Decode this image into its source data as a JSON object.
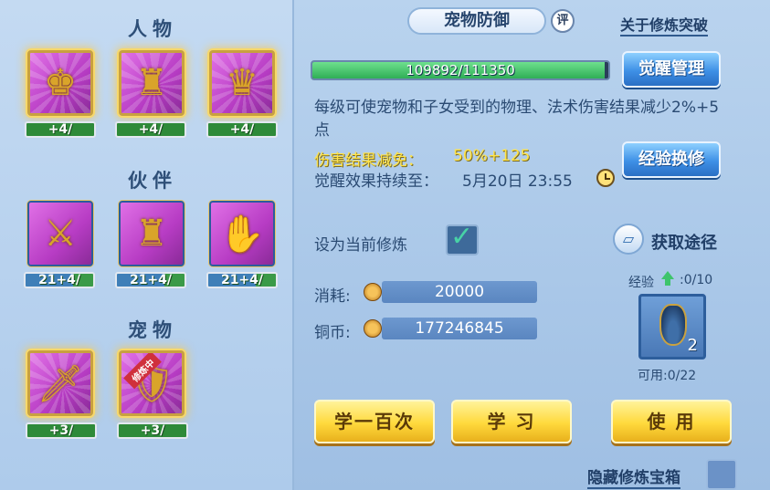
{
  "left": {
    "sections": [
      {
        "title": "人物"
      },
      {
        "title": "伙伴"
      },
      {
        "title": "宠物"
      }
    ],
    "character_slots": [
      {
        "level": "+4/"
      },
      {
        "level": "+4/"
      },
      {
        "level": "+4/"
      }
    ],
    "partner_slots": [
      {
        "level": "21+4/"
      },
      {
        "level": "21+4/"
      },
      {
        "level": "21+4/"
      }
    ],
    "pet_slots": [
      {
        "level": "+3/",
        "tag": ""
      },
      {
        "level": "+3/",
        "tag": "修炼中"
      }
    ]
  },
  "header": {
    "title": "宠物防御",
    "rate_icon": "评",
    "breakthrough_link": "关于修炼突破"
  },
  "progress": {
    "text": "109892/111350",
    "current": 109892,
    "max": 111350
  },
  "buttons": {
    "awaken": "觉醒管理",
    "exchange": "经验换修",
    "learn_100": "学一百次",
    "learn": "学 习",
    "use": "使 用"
  },
  "details": {
    "description": "每级可使宠物和子女受到的物理、法术伤害结果减少2%+5点",
    "reduction_label": "伤害结果减免：",
    "reduction_value": "50%+125",
    "expire_label": "觉醒效果持续至：",
    "expire_value": "5月20日 23:55"
  },
  "settings": {
    "set_current_label": "设为当前修炼",
    "get_source_label": "获取途径"
  },
  "resources": {
    "cost_label": "消耗:",
    "cost_value": "20000",
    "copper_label": "铜币:",
    "copper_value": "177246845"
  },
  "item": {
    "exp_label": "经验",
    "exp_value": ":0/10",
    "count": "2",
    "available": "可用:0/22"
  },
  "footer": {
    "hide_chest_label": "隐藏修炼宝箱"
  },
  "colors": {
    "accent_blue": "#3e90e6",
    "gold_button": "#ffd93c",
    "highlight_yellow": "#ffe34a",
    "progress_green": "#2fae56"
  }
}
